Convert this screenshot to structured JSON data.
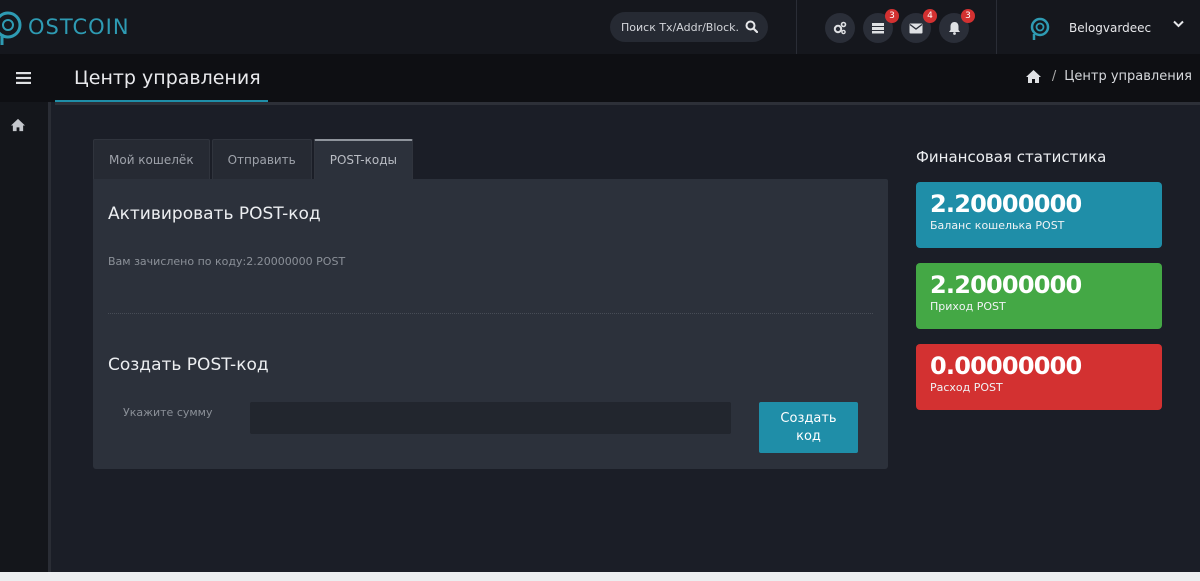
{
  "brand": {
    "logo_text": "OSTCOIN"
  },
  "search": {
    "placeholder": "Поиск Tx/Addr/Block."
  },
  "notifications": {
    "wallet_count": "3",
    "mail_count": "4",
    "bell_count": "3"
  },
  "user": {
    "name": "Belogvardeec"
  },
  "header": {
    "title": "Центр управления"
  },
  "breadcrumb": {
    "current": "Центр управления"
  },
  "tabs": [
    {
      "label": "Мой кошелёк"
    },
    {
      "label": "Отправить"
    },
    {
      "label": "POST-коды"
    }
  ],
  "activate": {
    "heading": "Активировать POST-код",
    "message": "Вам зачислено по коду:2.20000000 POST"
  },
  "create": {
    "heading": "Создать POST-код",
    "amount_label": "Укажите сумму",
    "amount_value": "",
    "button_label": "Создать код"
  },
  "stats": {
    "title": "Финансовая статистика",
    "items": [
      {
        "value": "2.20000000",
        "label": "Баланс кошелька POST",
        "color": "#1f8ea8"
      },
      {
        "value": "2.20000000",
        "label": "Приход POST",
        "color": "#44a845"
      },
      {
        "value": "0.00000000",
        "label": "Расход POST",
        "color": "#d33131"
      }
    ]
  }
}
